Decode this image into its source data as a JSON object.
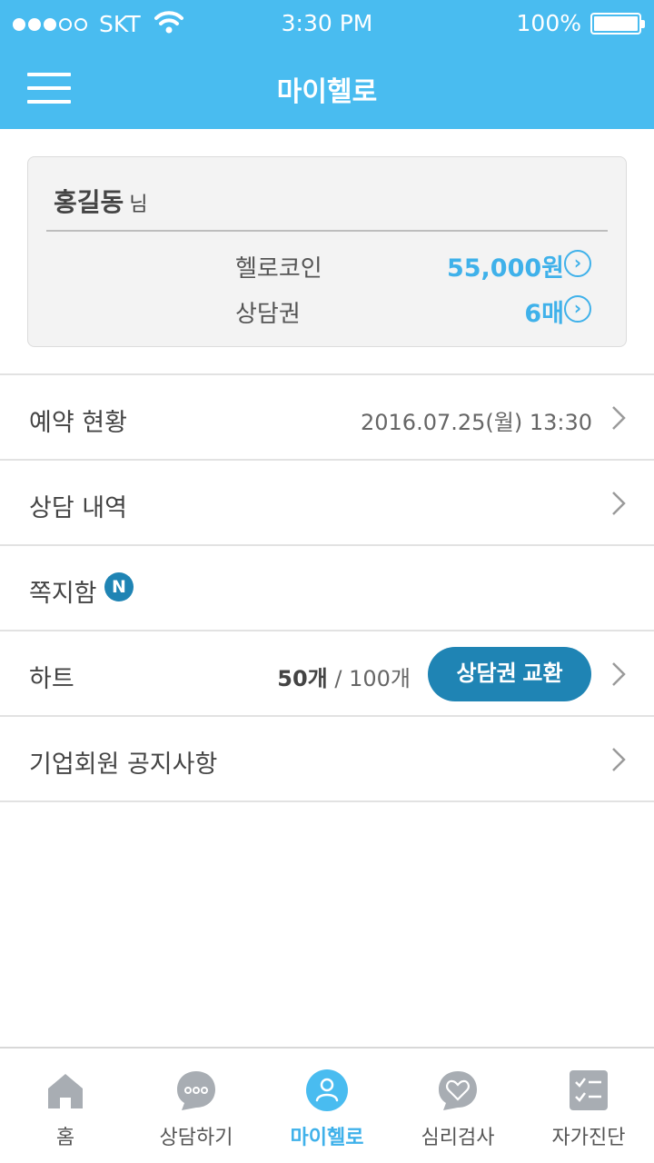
{
  "status_bar": {
    "carrier": "SKT",
    "time": "3:30 PM",
    "battery": "100%",
    "signal_bars_filled": 3,
    "signal_bars_total": 5
  },
  "header": {
    "title": "마이헬로",
    "menu_icon": "hamburger-menu-icon"
  },
  "profile": {
    "name": "홍길동",
    "suffix": "님",
    "coin_label": "헬로코인",
    "coin_value": "55,000원",
    "ticket_label": "상담권",
    "ticket_value": "6매"
  },
  "menu": {
    "reservation_label": "예약 현황",
    "reservation_date": "2016.07.25(월) 13:30",
    "history_label": "상담 내역",
    "messages_label": "쪽지함",
    "messages_badge": "N",
    "hearts_label": "하트",
    "hearts_count": "50개",
    "hearts_total": "/ 100개",
    "exchange_button": "상담권 교환",
    "notice_label": "기업회원 공지사항"
  },
  "tabs": [
    {
      "label": "홈",
      "icon": "home-icon"
    },
    {
      "label": "상담하기",
      "icon": "chat-bubble-icon"
    },
    {
      "label": "마이헬로",
      "icon": "person-icon",
      "active": true
    },
    {
      "label": "심리검사",
      "icon": "heart-bubble-icon"
    },
    {
      "label": "자가진단",
      "icon": "checklist-icon"
    }
  ],
  "colors": {
    "primary": "#49bcf0",
    "accent_dark": "#1f84b4",
    "tab_inactive": "#a8adb3"
  }
}
